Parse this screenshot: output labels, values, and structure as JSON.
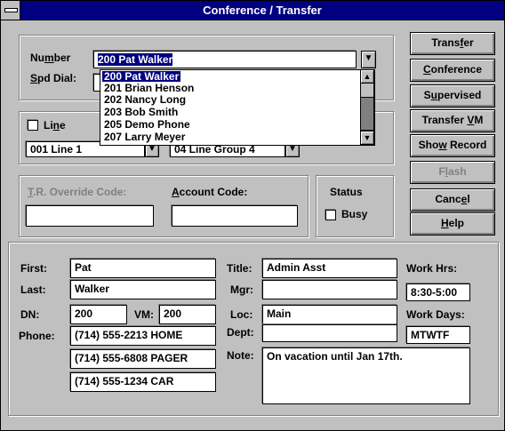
{
  "window": {
    "title": "Conference / Transfer"
  },
  "dial": {
    "number_label": "Number",
    "number_value": "200 Pat Walker",
    "spd_dial_label": "Spd Dial:",
    "dropdown_items": [
      "200 Pat Walker",
      "201 Brian Henson",
      "202 Nancy Long",
      "203 Bob Smith",
      "205 Demo Phone",
      "207 Larry Meyer"
    ],
    "line_label": "Line",
    "line_value": "001 Line  1",
    "group_value": "04 Line Group  4",
    "tr_override_label": "T.R. Override Code:",
    "account_code_label": "Account Code:",
    "status_label": "Status",
    "busy_label": "Busy"
  },
  "buttons": {
    "transfer": "Transfer",
    "conference": "Conference",
    "supervised": "Supervised",
    "transfer_vm": "Transfer VM",
    "show_record": "Show Record",
    "flash": "Flash",
    "cancel": "Cancel",
    "help": "Help"
  },
  "record": {
    "first_label": "First:",
    "first": "Pat",
    "last_label": "Last:",
    "last": "Walker",
    "dn_label": "DN:",
    "dn": "200",
    "vm_label": "VM:",
    "vm": "200",
    "phone_label": "Phone:",
    "phones": [
      "(714) 555-2213 HOME",
      "(714) 555-6808 PAGER",
      "(714) 555-1234 CAR"
    ],
    "title_label": "Title:",
    "title": "Admin Asst",
    "mgr_label": "Mgr:",
    "mgr": "",
    "loc_label": "Loc:",
    "loc": "Main",
    "dept_label": "Dept:",
    "dept": "",
    "note_label": "Note:",
    "note": "On vacation until Jan 17th.",
    "work_hrs_label": "Work Hrs:",
    "work_hrs": "8:30-5:00",
    "work_days_label": "Work Days:",
    "work_days": "MTWTF"
  },
  "icons": {
    "dropdown_arrow": "down-arrow-icon",
    "scroll_up": "up-arrow-icon",
    "scroll_down": "down-arrow-icon"
  }
}
